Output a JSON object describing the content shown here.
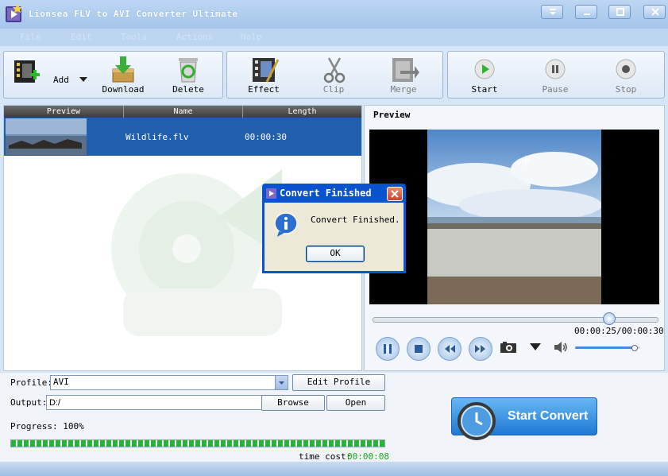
{
  "window": {
    "title": "Lionsea FLV to AVI Converter Ultimate"
  },
  "menu": [
    "File",
    "Edit",
    "Tools",
    "Actions",
    "Help"
  ],
  "toolbar": {
    "add": "Add",
    "download": "Download",
    "delete": "Delete",
    "effect": "Effect",
    "clip": "Clip",
    "merge": "Merge",
    "start": "Start",
    "pause": "Pause",
    "stop": "Stop"
  },
  "filelist": {
    "columns": [
      "Preview",
      "Name",
      "Length"
    ],
    "rows": [
      {
        "name": "Wildlife.flv",
        "length": "00:00:30"
      }
    ]
  },
  "preview": {
    "title": "Preview",
    "time": "00:00:25/00:00:30",
    "seek_position": 0.83,
    "volume": 0.9
  },
  "profile": {
    "label": "Profile:",
    "value": "AVI",
    "edit_button": "Edit Profile"
  },
  "output": {
    "label": "Output:",
    "value": "D:/",
    "browse_button": "Browse",
    "open_button": "Open"
  },
  "progress": {
    "label": "Progress: 100%",
    "value": 1.0,
    "time_cost_label": "time cost:",
    "time_cost": "00:00:08"
  },
  "convert_button": "Start Convert",
  "dialog": {
    "title": "Convert Finished",
    "message": "Convert Finished.",
    "ok": "OK"
  },
  "colors": {
    "selection": "#1f5fae",
    "dialog_title": "#0a53d0",
    "convert_button": "#2b8be0",
    "time_cost": "#1aa81a",
    "progress": "#27b535"
  }
}
